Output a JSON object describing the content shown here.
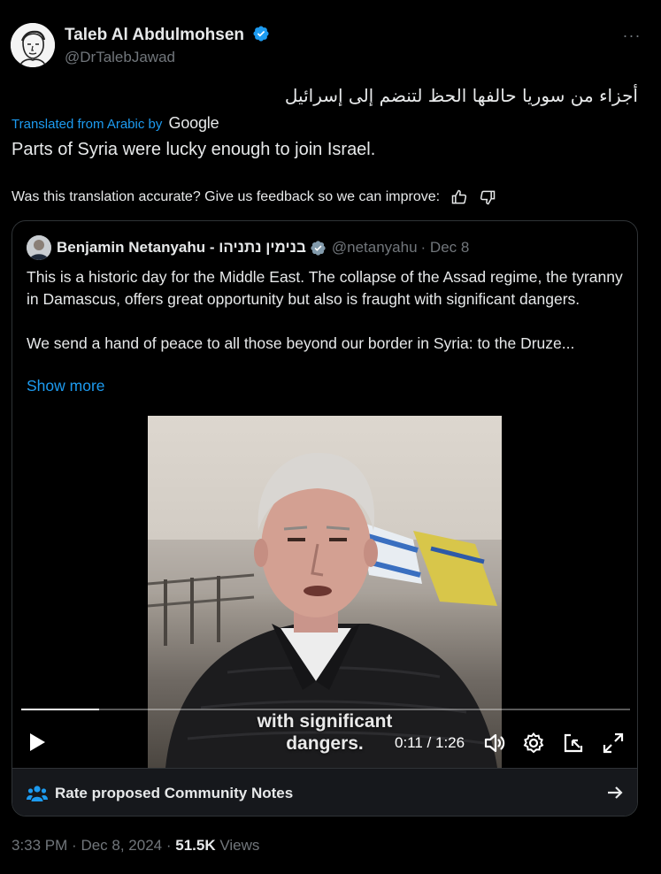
{
  "tweet": {
    "author_name": "Taleb Al Abdulmohsen",
    "author_handle": "@DrTalebJawad",
    "more_label": "···",
    "original_text": "أجزاء من سوريا حالفها الحظ لتنضم إلى إسرائيل",
    "translated_from": "Translated from Arabic by",
    "translator_brand": "Google",
    "translation": "Parts of Syria were lucky enough to join Israel.",
    "feedback_prompt": "Was this translation accurate? Give us feedback so we can improve:",
    "icons": {
      "verified": "verified-badge-icon",
      "thumbs_up": "thumbs-up-icon",
      "thumbs_down": "thumbs-down-icon",
      "more": "more-icon"
    }
  },
  "quote": {
    "author_name": "Benjamin Netanyahu - בנימין נתניהו",
    "author_handle": "@netanyahu",
    "date": "· Dec 8",
    "paragraph_1": "This is a historic day for the Middle East. The collapse of the Assad regime, the tyranny in Damascus, offers great opportunity but also is fraught with significant dangers.",
    "paragraph_2": "We send a hand of peace to all those beyond our border in Syria: to the Druze...",
    "show_more": "Show more"
  },
  "video": {
    "caption_line_1": "with significant",
    "caption_line_2": "dangers.",
    "time": "0:11 / 1:26",
    "progress": 0.128,
    "icons": [
      "play-icon",
      "volume-icon",
      "settings-icon",
      "picture-in-picture-icon",
      "fullscreen-icon"
    ]
  },
  "community_notes": {
    "label": "Rate proposed Community Notes",
    "icons": {
      "people": "people-icon",
      "arrow": "arrow-right-icon"
    }
  },
  "footer": {
    "time": "3:33 PM",
    "date": "Dec 8, 2024",
    "views_count": "51.5K",
    "views_label": "Views"
  },
  "colors": {
    "background": "#000000",
    "accent": "#1d9bf0",
    "muted": "#71767b",
    "text": "#e7e9ea"
  }
}
